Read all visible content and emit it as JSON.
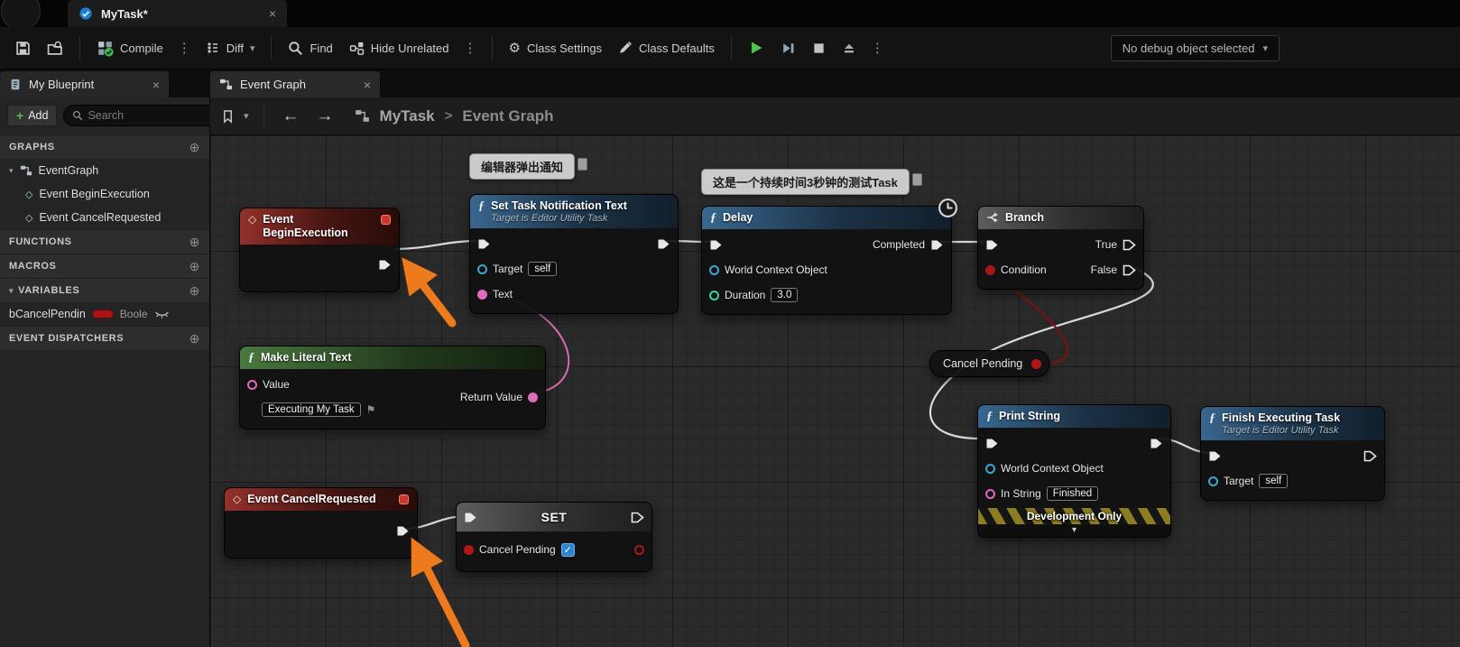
{
  "icons": {
    "close": "×",
    "chevron_down": "▾",
    "kebab": "⋮",
    "plus": "+",
    "circle_plus": "⊕",
    "gear": "⚙",
    "diamond": "◇",
    "flag": "⚑",
    "check": "✓",
    "fx": "ƒ",
    "back": "←",
    "forward": "→",
    "crumb_sep": ">"
  },
  "titlebar": {
    "tab": "MyTask*"
  },
  "toolbar": {
    "compile": "Compile",
    "diff": "Diff",
    "find": "Find",
    "hide_unrelated": "Hide Unrelated",
    "class_settings": "Class Settings",
    "class_defaults": "Class Defaults",
    "debug": "No debug object selected"
  },
  "tabs": {
    "my_blueprint": "My Blueprint",
    "event_graph": "Event Graph"
  },
  "blueprint_panel": {
    "add": "Add",
    "search_placeholder": "Search",
    "graphs": "GRAPHS",
    "eventgraph": "EventGraph",
    "event_begin": "Event BeginExecution",
    "event_cancel": "Event CancelRequested",
    "functions": "FUNCTIONS",
    "macros": "MACROS",
    "variables": "VARIABLES",
    "var_name": "bCancelPendin",
    "var_type": "Boole",
    "dispatchers": "EVENT DISPATCHERS"
  },
  "breadcrumb": {
    "root": "MyTask",
    "leaf": "Event Graph"
  },
  "graph": {
    "comments": {
      "notify": "编辑器弹出通知",
      "delay": "这是一个持续时间3秒钟的测试Task"
    },
    "nodes": {
      "begin": {
        "title": "Event BeginExecution"
      },
      "set_notify": {
        "title": "Set Task Notification Text",
        "subtitle": "Target is Editor Utility Task",
        "target_label": "Target",
        "target_value": "self",
        "text_label": "Text"
      },
      "delay": {
        "title": "Delay",
        "completed": "Completed",
        "wco": "World Context Object",
        "duration_label": "Duration",
        "duration_value": "3.0"
      },
      "branch": {
        "title": "Branch",
        "true_label": "True",
        "false_label": "False",
        "condition": "Condition"
      },
      "make_text": {
        "title": "Make Literal Text",
        "value_label": "Value",
        "value_text": "Executing My Task",
        "return_label": "Return Value"
      },
      "get_cancel": {
        "title": "Cancel Pending"
      },
      "cancel_req": {
        "title": "Event CancelRequested"
      },
      "set_var": {
        "title": "SET",
        "pin_label": "Cancel Pending"
      },
      "print": {
        "title": "Print String",
        "wco": "World Context Object",
        "in_string_label": "In String",
        "in_string_value": "Finished",
        "dev_only": "Development Only"
      },
      "finish": {
        "title": "Finish Executing Task",
        "subtitle": "Target is Editor Utility Task",
        "target_label": "Target",
        "target_value": "self"
      }
    }
  }
}
